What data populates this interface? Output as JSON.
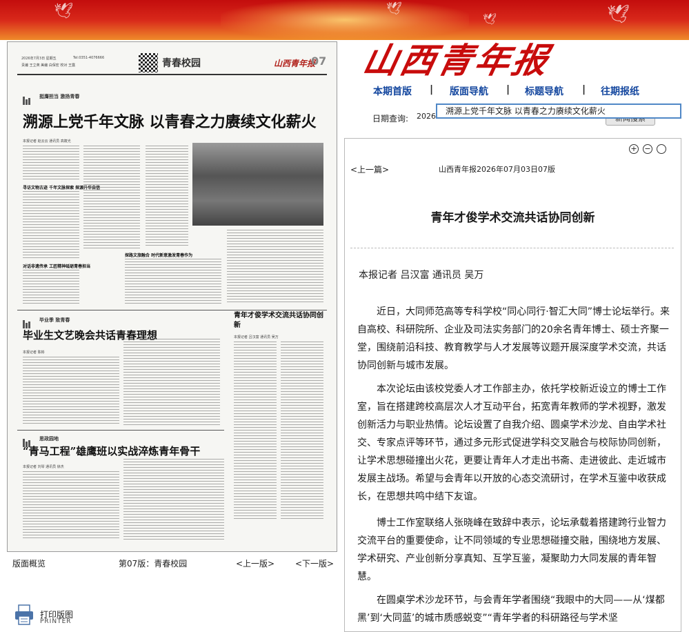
{
  "masthead": {
    "logo_text": "山西青年报"
  },
  "nav": {
    "items": [
      "本期首版",
      "版面导航",
      "标题导航",
      "往期报纸"
    ],
    "separator": "|"
  },
  "date_query": {
    "label": "日期查询:",
    "value": "2026",
    "button_label": "新闻搜索"
  },
  "tooltip": {
    "text": "溯源上党千年文脉 以青春之力赓续文化薪火"
  },
  "newspaper": {
    "date_line": "2026年7月3日  星期五",
    "tel": "Tel:0351-4076666",
    "editors": "责编 王立英  美编 白保宏  校对 王露",
    "page_title": "青春校园",
    "logo": "山西青年报",
    "page_number": "07",
    "section1_kicker": "挺膺担当  激扬青春",
    "section1_headline": "溯源上党千年文脉  以青春之力赓续文化薪火",
    "section1_byline": "本报记者 赵云云  通讯员 高筱光",
    "section1_sub1": "寻访文物古迹  千年文脉探索 探源升华自信",
    "section1_sub2": "对话非遗传承  工匠精神砥砺青春担当",
    "section1_sub3": "探路文旅融合  时代新意激发青春作为",
    "section2_kicker": "毕业季  致青春",
    "section2_headline": "毕业生文艺晚会共话青春理想",
    "section2_byline": "本报记者 陈彬",
    "section3_headline": "青年才俊学术交流共话协同创新",
    "section3_byline": "本报记者 吕汉富  通讯员 吴万",
    "section4_kicker": "思政园地",
    "section4_headline": "“青马工程”雄鹰班以实战淬炼青年骨干",
    "section4_byline": "本报记者 刘琴  通讯员 徐杰"
  },
  "page_nav": {
    "overview": "版面概览",
    "current_page": "第07版：青春校园",
    "prev": "<上一版>",
    "next": "<下一版>"
  },
  "print": {
    "label": "打印版图",
    "sub_label": "PRINTER"
  },
  "article": {
    "zoom_in": "+",
    "zoom_out": "−",
    "reset": "○",
    "prev_article": "<上一篇>",
    "info": "山西青年报2026年07月03日07版",
    "title": "青年才俊学术交流共话协同创新",
    "byline": "本报记者  吕汉富  通讯员  吴万",
    "paragraphs": [
      "近日，大同师范高等专科学校“同心同行·智汇大同”博士论坛举行。来自高校、科研院所、企业及司法实务部门的20余名青年博士、硕士齐聚一堂，围绕前沿科技、教育教学与人才发展等议题开展深度学术交流，共话协同创新与城市发展。",
      "本次论坛由该校党委人才工作部主办，依托学校新近设立的博士工作室，旨在搭建跨校高层次人才互动平台，拓宽青年教师的学术视野，激发创新活力与职业热情。论坛设置了自我介绍、圆桌学术沙龙、自由学术社交、专家点评等环节，通过多元形式促进学科交叉融合与校际协同创新，让学术思想碰撞出火花，更要让青年人才走出书斋、走进彼此、走近城市发展主战场。希望与会青年以开放的心态交流研讨，在学术互鉴中收获成长，在思想共鸣中结下友谊。",
      "博士工作室联络人张晓峰在致辞中表示，论坛承载着搭建跨行业智力交流平台的重要使命，让不同领域的专业思想碰撞交融，围绕地方发展、学术研究、产业创新分享真知、互学互鉴，凝聚助力大同发展的青年智慧。",
      "在圆桌学术沙龙环节，与会青年学者围绕“我眼中的大同——从‘煤都黑’到‘大同蓝’的城市质感蜕变”“青年学者的科研路径与学术坚"
    ]
  }
}
